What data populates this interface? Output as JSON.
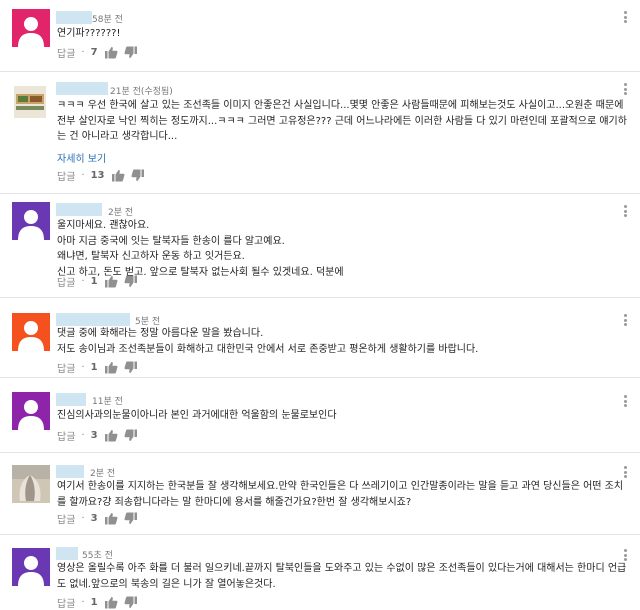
{
  "reply_label": "답글",
  "dot": "·",
  "more_label": "자세히 보기",
  "comments": [
    {
      "time": "58분 전",
      "text": "연기파??????!",
      "likes": "7",
      "avatar_color": "#e2246a"
    },
    {
      "time": "21분 전(수정됨)",
      "text": "ㅋㅋㅋ 우선 한국에 살고 있는 조선족들 이미지 안좋은건 사실입니다...몇몇 안좋은 사람들때문에 피해보는것도 사실이고...오원춘 때문에 전부 살인자로 낙인 찍히는 정도까지...ㅋㅋㅋ 그러면 고유정은??? 근데 어느나라에든 이러한 사람들 다 있기 마련인데 포괄적으로 얘기하는 건 아니라고 생각합니다...",
      "likes": "13"
    },
    {
      "time": "2분 전",
      "text": "울지마세요. 괜찮아요.\n아마 지금 중국에 잇는 탈북자들 한송이 를다 알고예요.\n왜냐면, 탈북자 신고하자 운동 하고 잇거든요.\n신고 하고, 돈도 벋고. 앞으로 탈북자 없는사회 될수 있겟네요. 덕분에",
      "likes": "1",
      "avatar_color": "#6a38b3"
    },
    {
      "time": "5분 전",
      "text": "댓글 중에 화해라는 정말 아름다운 말을 봤습니다.\n저도 송이님과 조선족분들이 화해하고 대한민국 안에서 서로 존중받고 평온하게 생활하기를 바랍니다.",
      "likes": "1",
      "avatar_color": "#f4511e"
    },
    {
      "time": "11분 전",
      "text": "진심의사과의눈물이아니라  본인 과거에대한 억울함의 눈물로보인다",
      "likes": "3",
      "avatar_color": "#8e24aa"
    },
    {
      "time": "2분 전",
      "text": "여기서 한송이를 지지하는 한국분들 잘 생각해보세요.만약 한국인들은 다 쓰레기이고 인간말종이라는 말을 듣고 과연 당신들은 어떤 조치를 할까요?걍 죄송합니다라는 말 한마디에 용서를 해줄건가요?한번 잘 생각해보시죠?",
      "likes": "3"
    },
    {
      "time": "55초 전",
      "text": "영상은 올릴수록 아주 화를 더 불러 일으키네.끝까지 탈북인들을 도와주고 있는 수없이 많은 조선족들이 있다는거에 대해서는 한마디 언급도 없네.앞으로의 북송의 길은 니가 잘 열어놓은것다.",
      "likes": "1",
      "avatar_color": "#6a38b3"
    }
  ]
}
